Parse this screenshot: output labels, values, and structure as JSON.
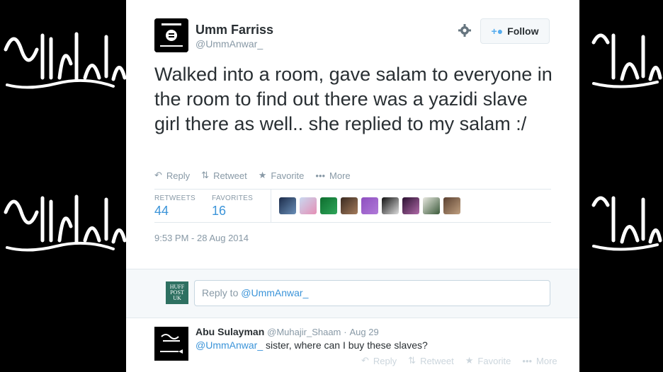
{
  "tweet": {
    "author_name": "Umm Farriss",
    "author_handle": "@UmmAnwar_",
    "follow_label": "Follow",
    "text": "Walked into a room, gave salam to everyone in the room to find out there was a yazidi slave girl there as well.. she replied to my salam :/",
    "actions": {
      "reply": "Reply",
      "retweet": "Retweet",
      "favorite": "Favorite",
      "more": "More"
    },
    "stats": {
      "retweets_label": "RETWEETS",
      "retweets_value": "44",
      "favorites_label": "FAVORITES",
      "favorites_value": "16"
    },
    "timestamp": "9:53 PM - 28 Aug 2014"
  },
  "reply_box": {
    "logo_lines": [
      "HUFF",
      "POST",
      "UK"
    ],
    "prefix": "Reply to ",
    "mention": "@UmmAnwar_"
  },
  "reply_tweet": {
    "author_name": "Abu Sulayman",
    "author_handle": "@Muhajir_Shaam",
    "date": "Aug 29",
    "mention": "@UmmAnwar_",
    "text": " sister, where can I buy these slaves?",
    "actions": {
      "reply": "Reply",
      "retweet": "Retweet",
      "favorite": "Favorite",
      "more": "More"
    }
  },
  "colors": {
    "accent": "#3b94d9",
    "follow_icon": "#55acee",
    "muted": "#8899a6",
    "text": "#292f33",
    "huffpost_green": "#2e7061"
  }
}
